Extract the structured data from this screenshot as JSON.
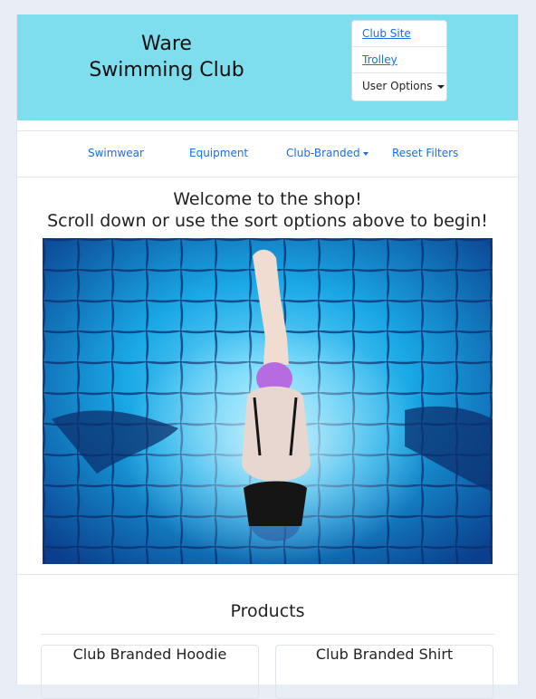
{
  "brand": {
    "line1": "Ware",
    "line2": "Swimming Club"
  },
  "header_menu": {
    "club_site": "Club Site",
    "trolley": "Trolley",
    "user_options": "User Options"
  },
  "nav": {
    "swimwear": "Swimwear",
    "equipment": "Equipment",
    "club_branded": "Club-Branded",
    "reset_filters": "Reset Filters"
  },
  "welcome": {
    "line1": "Welcome to the shop!",
    "line2": "Scroll down or use the sort options above to begin!"
  },
  "products": {
    "heading": "Products",
    "items": [
      {
        "title": "Club Branded Hoodie"
      },
      {
        "title": "Club Branded Shirt"
      }
    ]
  },
  "colors": {
    "header_bg": "#7fdeee",
    "link": "#1b6fe0",
    "page_bg": "#e9edf6"
  }
}
